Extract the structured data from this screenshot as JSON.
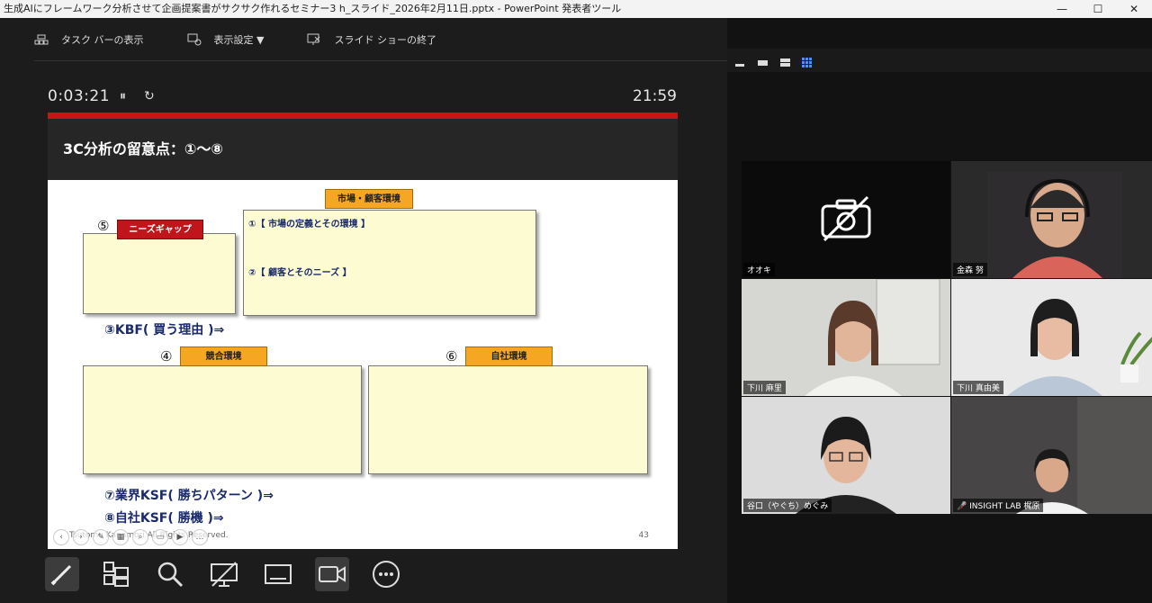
{
  "window": {
    "title": "生成AIにフレームワーク分析させて企画提案書がサクサク作れるセミナー3 h_スライド_2026年2月11日.pptx - PowerPoint 発表者ツール",
    "minimize": "—",
    "maximize": "☐",
    "close": "✕"
  },
  "toolbar": {
    "taskbar_label": "タスク バーの表示",
    "display_settings_label": "表示設定 ▼",
    "end_show_label": "スライド ショーの終了"
  },
  "timer": {
    "elapsed": "0:03:21",
    "pause": "⏸",
    "reset": "↻",
    "clock": "21:59"
  },
  "slide": {
    "title": "3C分析の留意点：①～⑧",
    "tag_market": "市場・顧客環境",
    "tag_needs_gap": "ニーズギャップ",
    "tag_competition": "競合環境",
    "tag_company": "自社環境",
    "num5": "⑤",
    "num4": "④",
    "num6": "⑥",
    "market_line1": "①【 市場の定義とその環境 】",
    "market_line2": "②【 顧客とそのニーズ 】",
    "kbf": "③KBF( 買う理由 )⇒",
    "ksf_industry": "⑦業界KSF( 勝ちパターン )⇒",
    "ksf_company": "⑧自社KSF( 勝機 )⇒",
    "footer": "Tsutomu Kanamori All Rights Reserved.",
    "page_number": "43"
  },
  "participants": [
    {
      "name": "オオキ",
      "camera_off": true
    },
    {
      "name": "金森 努",
      "camera_off": false
    },
    {
      "name": "下川 麻里",
      "camera_off": false
    },
    {
      "name": "下川 真由美",
      "camera_off": false,
      "speaking": true
    },
    {
      "name": "谷口（やぐち）めぐみ",
      "camera_off": false
    },
    {
      "name": "INSIGHT LAB 梶原",
      "camera_off": false,
      "muted": true
    }
  ]
}
